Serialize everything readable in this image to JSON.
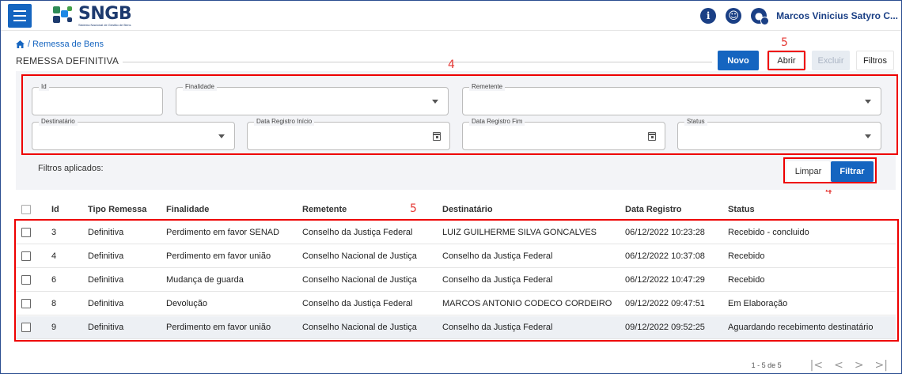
{
  "header": {
    "menu_icon": "menu-icon",
    "logo_title": "SNGB",
    "logo_subtitle": "Sistema Nacional de Gestão de Bens",
    "info_icon": "info-icon",
    "accessibility_icon": "accessibility-icon",
    "user_icon": "user-avatar-icon",
    "user_name": "Marcos Vinicius Satyro C..."
  },
  "breadcrumb": {
    "home_icon": "home-icon",
    "text": "/ Remessa de Bens"
  },
  "page": {
    "title": "REMESSA DEFINITIVA"
  },
  "toolbar": {
    "novo_label": "Novo",
    "abrir_label": "Abrir",
    "excluir_label": "Excluir",
    "filtros_label": "Filtros"
  },
  "annotations": {
    "toolbar": "5",
    "filters": "4",
    "actions": "4",
    "table": "5"
  },
  "filters": {
    "id_label": "Id",
    "finalidade_label": "Finalidade",
    "remetente_label": "Remetente",
    "destinatario_label": "Destinatário",
    "data_inicio_label": "Data Registro Início",
    "data_fim_label": "Data Registro Fim",
    "status_label": "Status",
    "applied_label": "Filtros aplicados:",
    "limpar_label": "Limpar",
    "filtrar_label": "Filtrar"
  },
  "table": {
    "columns": [
      "Id",
      "Tipo Remessa",
      "Finalidade",
      "Remetente",
      "Destinatário",
      "Data Registro",
      "Status"
    ],
    "rows": [
      {
        "id": "3",
        "tipo": "Definitiva",
        "finalidade": "Perdimento em favor SENAD",
        "remetente": "Conselho da Justiça Federal",
        "destinatario": "LUIZ GUILHERME SILVA GONCALVES",
        "data": "06/12/2022 10:23:28",
        "status": "Recebido - concluido"
      },
      {
        "id": "4",
        "tipo": "Definitiva",
        "finalidade": "Perdimento em favor união",
        "remetente": "Conselho Nacional de Justiça",
        "destinatario": "Conselho da Justiça Federal",
        "data": "06/12/2022 10:37:08",
        "status": "Recebido"
      },
      {
        "id": "6",
        "tipo": "Definitiva",
        "finalidade": "Mudança de guarda",
        "remetente": "Conselho Nacional de Justiça",
        "destinatario": "Conselho da Justiça Federal",
        "data": "06/12/2022 10:47:29",
        "status": "Recebido"
      },
      {
        "id": "8",
        "tipo": "Definitiva",
        "finalidade": "Devolução",
        "remetente": "Conselho da Justiça Federal",
        "destinatario": "MARCOS ANTONIO CODECO CORDEIRO",
        "data": "09/12/2022 09:47:51",
        "status": "Em Elaboração"
      },
      {
        "id": "9",
        "tipo": "Definitiva",
        "finalidade": "Perdimento em favor união",
        "remetente": "Conselho Nacional de Justiça",
        "destinatario": "Conselho da Justiça Federal",
        "data": "09/12/2022 09:52:25",
        "status": "Aguardando recebimento destinatário"
      }
    ]
  },
  "pagination": {
    "range": "1 - 5 de 5",
    "first": "|<",
    "prev": "<",
    "next": ">",
    "last": ">|"
  },
  "colors": {
    "primary": "#1565c0",
    "brand_dark": "#1a3f85",
    "highlight": "#e00000"
  }
}
